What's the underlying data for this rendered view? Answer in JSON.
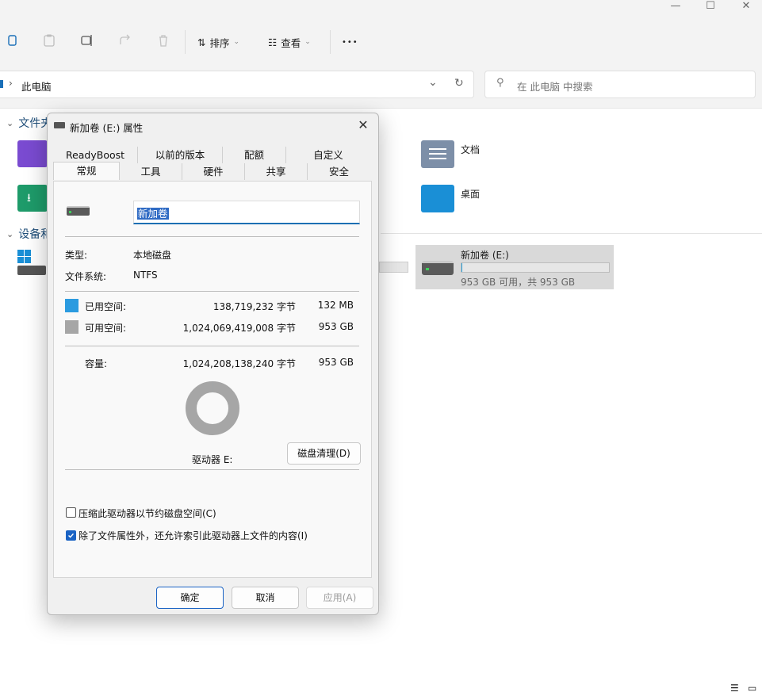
{
  "window": {
    "minimize_glyph": "—",
    "maximize_glyph": "☐",
    "close_glyph": "✕"
  },
  "toolbar": {
    "sort_label": "排序",
    "view_label": "查看",
    "more_label": "•••"
  },
  "address": {
    "path_label": "此电脑"
  },
  "search": {
    "placeholder": "在 此电脑 中搜索"
  },
  "sections": {
    "folders_head": "文件夹",
    "devices_head": "设备和"
  },
  "folders": [
    {
      "label": "文档",
      "icon": "documents-folder-icon"
    },
    {
      "label": "桌面",
      "icon": "desktop-folder-icon"
    }
  ],
  "drive_tile": {
    "name": "新加卷 (E:)",
    "space_text": "953 GB 可用，共 953 GB",
    "used_fraction": 0.001
  },
  "dialog": {
    "title": "新加卷 (E:) 属性",
    "tabs_row1": [
      "ReadyBoost",
      "以前的版本",
      "配额",
      "自定义"
    ],
    "tabs_row2": [
      "常规",
      "工具",
      "硬件",
      "共享",
      "安全"
    ],
    "active_tab": "常规",
    "volume_name": "新加卷",
    "type_label": "类型:",
    "type_value": "本地磁盘",
    "fs_label": "文件系统:",
    "fs_value": "NTFS",
    "used_label": "已用空间:",
    "used_bytes": "138,719,232 字节",
    "used_size": "132 MB",
    "free_label": "可用空间:",
    "free_bytes": "1,024,069,419,008 字节",
    "free_size": "953 GB",
    "cap_label": "容量:",
    "cap_bytes": "1,024,208,138,240 字节",
    "cap_size": "953 GB",
    "drive_label": "驱动器 E:",
    "cleanup_button": "磁盘清理(D)",
    "compress_label": "压缩此驱动器以节约磁盘空间(C)",
    "compress_checked": false,
    "index_label": "除了文件属性外，还允许索引此驱动器上文件的内容(I)",
    "index_checked": true,
    "ok_button": "确定",
    "cancel_button": "取消",
    "apply_button": "应用(A)",
    "used_color": "#2b9be0",
    "free_color": "#a6a6a6",
    "used_fraction": 0.00014
  }
}
